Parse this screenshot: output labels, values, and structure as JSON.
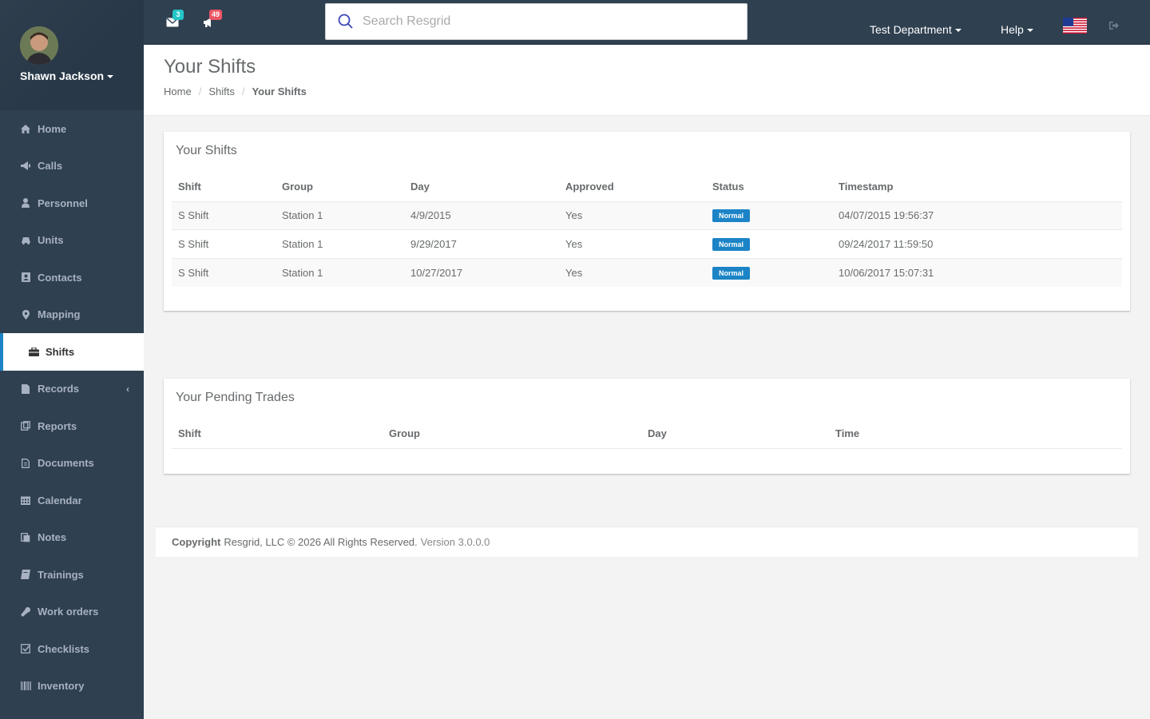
{
  "user": {
    "name": "Shawn Jackson"
  },
  "sidebar": {
    "items": [
      {
        "label": "Home",
        "icon": "home-icon"
      },
      {
        "label": "Calls",
        "icon": "bullhorn-icon"
      },
      {
        "label": "Personnel",
        "icon": "user-icon"
      },
      {
        "label": "Units",
        "icon": "truck-icon"
      },
      {
        "label": "Contacts",
        "icon": "address-book-icon"
      },
      {
        "label": "Mapping",
        "icon": "map-marker-icon"
      },
      {
        "label": "Shifts",
        "icon": "briefcase-icon",
        "active": true
      },
      {
        "label": "Records",
        "icon": "file-icon",
        "expandable": true
      },
      {
        "label": "Reports",
        "icon": "report-icon"
      },
      {
        "label": "Documents",
        "icon": "document-icon"
      },
      {
        "label": "Calendar",
        "icon": "calendar-icon"
      },
      {
        "label": "Notes",
        "icon": "notes-icon"
      },
      {
        "label": "Trainings",
        "icon": "book-icon"
      },
      {
        "label": "Work orders",
        "icon": "wrench-icon"
      },
      {
        "label": "Checklists",
        "icon": "check-square-icon"
      },
      {
        "label": "Inventory",
        "icon": "barcode-icon"
      }
    ],
    "expand_arrow": "‹"
  },
  "topbar": {
    "messages_count": "3",
    "calls_count": "49",
    "search_placeholder": "Search Resgrid",
    "department": "Test Department",
    "help": "Help"
  },
  "colors": {
    "accent": "#1c84c6",
    "sidebar_bg": "#2f4050",
    "messages_badge": "#23c6c8",
    "calls_badge": "#ed5565"
  },
  "page": {
    "title": "Your Shifts",
    "breadcrumb": [
      "Home",
      "Shifts",
      "Your Shifts"
    ]
  },
  "shifts_panel": {
    "title": "Your Shifts",
    "columns": [
      "Shift",
      "Group",
      "Day",
      "Approved",
      "Status",
      "Timestamp"
    ],
    "rows": [
      {
        "shift": "S Shift",
        "group": "Station 1",
        "day": "4/9/2015",
        "approved": "Yes",
        "status": "Normal",
        "timestamp": "04/07/2015 19:56:37"
      },
      {
        "shift": "S Shift",
        "group": "Station 1",
        "day": "9/29/2017",
        "approved": "Yes",
        "status": "Normal",
        "timestamp": "09/24/2017 11:59:50"
      },
      {
        "shift": "S Shift",
        "group": "Station 1",
        "day": "10/27/2017",
        "approved": "Yes",
        "status": "Normal",
        "timestamp": "10/06/2017 15:07:31"
      }
    ]
  },
  "trades_panel": {
    "title": "Your Pending Trades",
    "columns": [
      "Shift",
      "Group",
      "Day",
      "Time"
    ]
  },
  "footer": {
    "copyright_label": "Copyright",
    "copyright_text": "Resgrid, LLC © 2026 All Rights Reserved.",
    "version": "Version 3.0.0.0"
  }
}
